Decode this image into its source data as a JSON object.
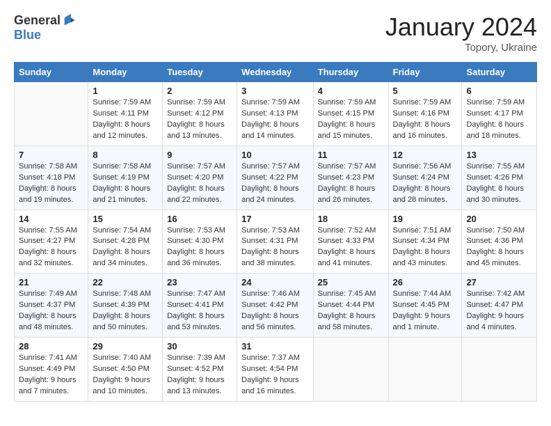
{
  "logo": {
    "general": "General",
    "blue": "Blue"
  },
  "title": "January 2024",
  "location": "Topory, Ukraine",
  "days_of_week": [
    "Sunday",
    "Monday",
    "Tuesday",
    "Wednesday",
    "Thursday",
    "Friday",
    "Saturday"
  ],
  "weeks": [
    [
      {
        "day": "",
        "sunrise": "",
        "sunset": "",
        "daylight": ""
      },
      {
        "day": "1",
        "sunrise": "Sunrise: 7:59 AM",
        "sunset": "Sunset: 4:11 PM",
        "daylight": "Daylight: 8 hours and 12 minutes."
      },
      {
        "day": "2",
        "sunrise": "Sunrise: 7:59 AM",
        "sunset": "Sunset: 4:12 PM",
        "daylight": "Daylight: 8 hours and 13 minutes."
      },
      {
        "day": "3",
        "sunrise": "Sunrise: 7:59 AM",
        "sunset": "Sunset: 4:13 PM",
        "daylight": "Daylight: 8 hours and 14 minutes."
      },
      {
        "day": "4",
        "sunrise": "Sunrise: 7:59 AM",
        "sunset": "Sunset: 4:15 PM",
        "daylight": "Daylight: 8 hours and 15 minutes."
      },
      {
        "day": "5",
        "sunrise": "Sunrise: 7:59 AM",
        "sunset": "Sunset: 4:16 PM",
        "daylight": "Daylight: 8 hours and 16 minutes."
      },
      {
        "day": "6",
        "sunrise": "Sunrise: 7:59 AM",
        "sunset": "Sunset: 4:17 PM",
        "daylight": "Daylight: 8 hours and 18 minutes."
      }
    ],
    [
      {
        "day": "7",
        "sunrise": "Sunrise: 7:58 AM",
        "sunset": "Sunset: 4:18 PM",
        "daylight": "Daylight: 8 hours and 19 minutes."
      },
      {
        "day": "8",
        "sunrise": "Sunrise: 7:58 AM",
        "sunset": "Sunset: 4:19 PM",
        "daylight": "Daylight: 8 hours and 21 minutes."
      },
      {
        "day": "9",
        "sunrise": "Sunrise: 7:57 AM",
        "sunset": "Sunset: 4:20 PM",
        "daylight": "Daylight: 8 hours and 22 minutes."
      },
      {
        "day": "10",
        "sunrise": "Sunrise: 7:57 AM",
        "sunset": "Sunset: 4:22 PM",
        "daylight": "Daylight: 8 hours and 24 minutes."
      },
      {
        "day": "11",
        "sunrise": "Sunrise: 7:57 AM",
        "sunset": "Sunset: 4:23 PM",
        "daylight": "Daylight: 8 hours and 26 minutes."
      },
      {
        "day": "12",
        "sunrise": "Sunrise: 7:56 AM",
        "sunset": "Sunset: 4:24 PM",
        "daylight": "Daylight: 8 hours and 28 minutes."
      },
      {
        "day": "13",
        "sunrise": "Sunrise: 7:55 AM",
        "sunset": "Sunset: 4:26 PM",
        "daylight": "Daylight: 8 hours and 30 minutes."
      }
    ],
    [
      {
        "day": "14",
        "sunrise": "Sunrise: 7:55 AM",
        "sunset": "Sunset: 4:27 PM",
        "daylight": "Daylight: 8 hours and 32 minutes."
      },
      {
        "day": "15",
        "sunrise": "Sunrise: 7:54 AM",
        "sunset": "Sunset: 4:28 PM",
        "daylight": "Daylight: 8 hours and 34 minutes."
      },
      {
        "day": "16",
        "sunrise": "Sunrise: 7:53 AM",
        "sunset": "Sunset: 4:30 PM",
        "daylight": "Daylight: 8 hours and 36 minutes."
      },
      {
        "day": "17",
        "sunrise": "Sunrise: 7:53 AM",
        "sunset": "Sunset: 4:31 PM",
        "daylight": "Daylight: 8 hours and 38 minutes."
      },
      {
        "day": "18",
        "sunrise": "Sunrise: 7:52 AM",
        "sunset": "Sunset: 4:33 PM",
        "daylight": "Daylight: 8 hours and 41 minutes."
      },
      {
        "day": "19",
        "sunrise": "Sunrise: 7:51 AM",
        "sunset": "Sunset: 4:34 PM",
        "daylight": "Daylight: 8 hours and 43 minutes."
      },
      {
        "day": "20",
        "sunrise": "Sunrise: 7:50 AM",
        "sunset": "Sunset: 4:36 PM",
        "daylight": "Daylight: 8 hours and 45 minutes."
      }
    ],
    [
      {
        "day": "21",
        "sunrise": "Sunrise: 7:49 AM",
        "sunset": "Sunset: 4:37 PM",
        "daylight": "Daylight: 8 hours and 48 minutes."
      },
      {
        "day": "22",
        "sunrise": "Sunrise: 7:48 AM",
        "sunset": "Sunset: 4:39 PM",
        "daylight": "Daylight: 8 hours and 50 minutes."
      },
      {
        "day": "23",
        "sunrise": "Sunrise: 7:47 AM",
        "sunset": "Sunset: 4:41 PM",
        "daylight": "Daylight: 8 hours and 53 minutes."
      },
      {
        "day": "24",
        "sunrise": "Sunrise: 7:46 AM",
        "sunset": "Sunset: 4:42 PM",
        "daylight": "Daylight: 8 hours and 56 minutes."
      },
      {
        "day": "25",
        "sunrise": "Sunrise: 7:45 AM",
        "sunset": "Sunset: 4:44 PM",
        "daylight": "Daylight: 8 hours and 58 minutes."
      },
      {
        "day": "26",
        "sunrise": "Sunrise: 7:44 AM",
        "sunset": "Sunset: 4:45 PM",
        "daylight": "Daylight: 9 hours and 1 minute."
      },
      {
        "day": "27",
        "sunrise": "Sunrise: 7:42 AM",
        "sunset": "Sunset: 4:47 PM",
        "daylight": "Daylight: 9 hours and 4 minutes."
      }
    ],
    [
      {
        "day": "28",
        "sunrise": "Sunrise: 7:41 AM",
        "sunset": "Sunset: 4:49 PM",
        "daylight": "Daylight: 9 hours and 7 minutes."
      },
      {
        "day": "29",
        "sunrise": "Sunrise: 7:40 AM",
        "sunset": "Sunset: 4:50 PM",
        "daylight": "Daylight: 9 hours and 10 minutes."
      },
      {
        "day": "30",
        "sunrise": "Sunrise: 7:39 AM",
        "sunset": "Sunset: 4:52 PM",
        "daylight": "Daylight: 9 hours and 13 minutes."
      },
      {
        "day": "31",
        "sunrise": "Sunrise: 7:37 AM",
        "sunset": "Sunset: 4:54 PM",
        "daylight": "Daylight: 9 hours and 16 minutes."
      },
      {
        "day": "",
        "sunrise": "",
        "sunset": "",
        "daylight": ""
      },
      {
        "day": "",
        "sunrise": "",
        "sunset": "",
        "daylight": ""
      },
      {
        "day": "",
        "sunrise": "",
        "sunset": "",
        "daylight": ""
      }
    ]
  ]
}
